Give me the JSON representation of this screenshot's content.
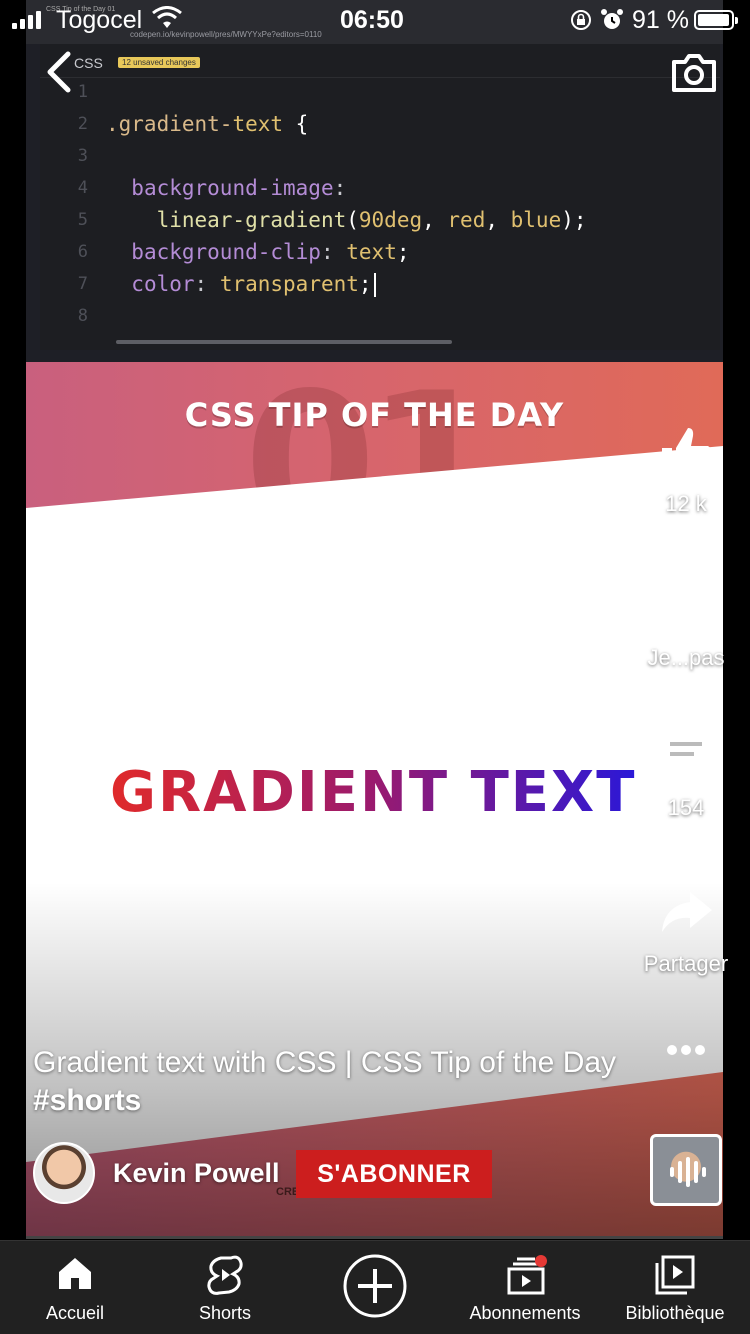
{
  "status_bar": {
    "carrier": "Togocel",
    "time": "06:50",
    "battery": "91 %",
    "battery_level": 0.91,
    "icons": [
      "signal-icon",
      "wifi-icon",
      "orientation-lock-icon",
      "alarm-icon",
      "battery-icon"
    ]
  },
  "video": {
    "browser": {
      "tab_title": "CSS Tip of the Day 01",
      "url": "codepen.io/kevinpowell/pres/MWYYxPe?editors=0110"
    },
    "editor": {
      "label": "CSS",
      "unsaved": "12 unsaved changes",
      "lines": [
        {
          "n": "1",
          "text": ""
        },
        {
          "n": "2",
          "text": ".gradient-text {"
        },
        {
          "n": "3",
          "text": ""
        },
        {
          "n": "4",
          "text": "  background-image:"
        },
        {
          "n": "5",
          "text": "    linear-gradient(90deg, red, blue);"
        },
        {
          "n": "6",
          "text": "  background-clip: text;"
        },
        {
          "n": "7",
          "text": "  color: transparent;"
        },
        {
          "n": "8",
          "text": ""
        }
      ]
    },
    "graphic": {
      "big_number": "01",
      "tip_title": "CSS TIP OF THE DAY",
      "headline": "GRADIENT TEXT",
      "created_by": "CREATED BY"
    }
  },
  "actions": {
    "like": {
      "label": "12 k",
      "icon": "thumbs-up-icon"
    },
    "dislike": {
      "label": "Je...pas",
      "icon": "thumbs-down-icon"
    },
    "comment": {
      "label": "154",
      "icon": "comment-icon"
    },
    "share": {
      "label": "Partager",
      "icon": "share-icon"
    },
    "more": {
      "icon": "more-icon"
    }
  },
  "title": {
    "text": "Gradient text with CSS | CSS Tip of the Day ",
    "hashtag": "#shorts"
  },
  "channel": {
    "name": "Kevin Powell",
    "subscribe": "S'ABONNER"
  },
  "nav": {
    "home": "Accueil",
    "shorts": "Shorts",
    "subscriptions": "Abonnements",
    "library": "Bibliothèque"
  },
  "colors": {
    "subscribe": "#cc1e1e",
    "nav_background": "#212121",
    "notification_dot": "#e53935"
  }
}
